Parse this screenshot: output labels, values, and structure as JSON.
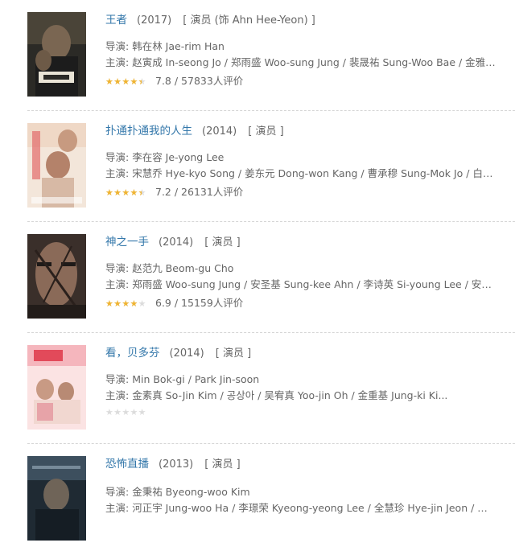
{
  "labels": {
    "director": "导演:",
    "cast": "主演:"
  },
  "items": [
    {
      "title": "王者",
      "year": "(2017)",
      "role": "[ 演员 (饰 Ahn Hee-Yeon) ]",
      "director": "韩在林 Jae-rim Han",
      "cast": "赵寅成 In-seong Jo / 郑雨盛 Woo-sung Jung / 裴晟祐 Sung-Woo Bae / 金雅中...",
      "stars": 4,
      "rating_text": "7.8 / 57833人评价"
    },
    {
      "title": "扑通扑通我的人生",
      "year": "(2014)",
      "role": "[ 演员 ]",
      "director": "李在容 Je-yong Lee",
      "cast": "宋慧乔 Hye-kyo Song / 姜东元 Dong-won Kang / 曹承穆 Sung-Mok Jo / 白日燮...",
      "stars": 4,
      "rating_text": "7.2 / 26131人评价"
    },
    {
      "title": "神之一手",
      "year": "(2014)",
      "role": "[ 演员 ]",
      "director": "赵范九 Beom-gu Cho",
      "cast": "郑雨盛 Woo-sung Jung / 安圣基 Sung-kee Ahn / 李诗英 Si-young Lee / 安吉...",
      "stars": 3.5,
      "rating_text": "6.9 / 15159人评价"
    },
    {
      "title": "看，贝多芬",
      "year": "(2014)",
      "role": "[ 演员 ]",
      "director": "Min Bok-gi / Park Jin-soon",
      "cast": "金素真 So-Jin Kim / 공상아 / 吴宥真 Yoo-jin Oh / 金重基 Jung-ki Ki...",
      "stars": 0,
      "rating_text": ""
    },
    {
      "title": "恐怖直播",
      "year": "(2013)",
      "role": "[ 演员 ]",
      "director": "金秉祐 Byeong-woo Kim",
      "cast": "河正宇 Jung-woo Ha / 李璟荣 Kyeong-yeong Lee / 全慧珍 Hye-jin Jeon / 李...",
      "stars": 0,
      "rating_text": ""
    }
  ],
  "colors": {
    "link": "#3377aa",
    "star": "#f0b431",
    "star_empty": "#dcdcdc"
  }
}
